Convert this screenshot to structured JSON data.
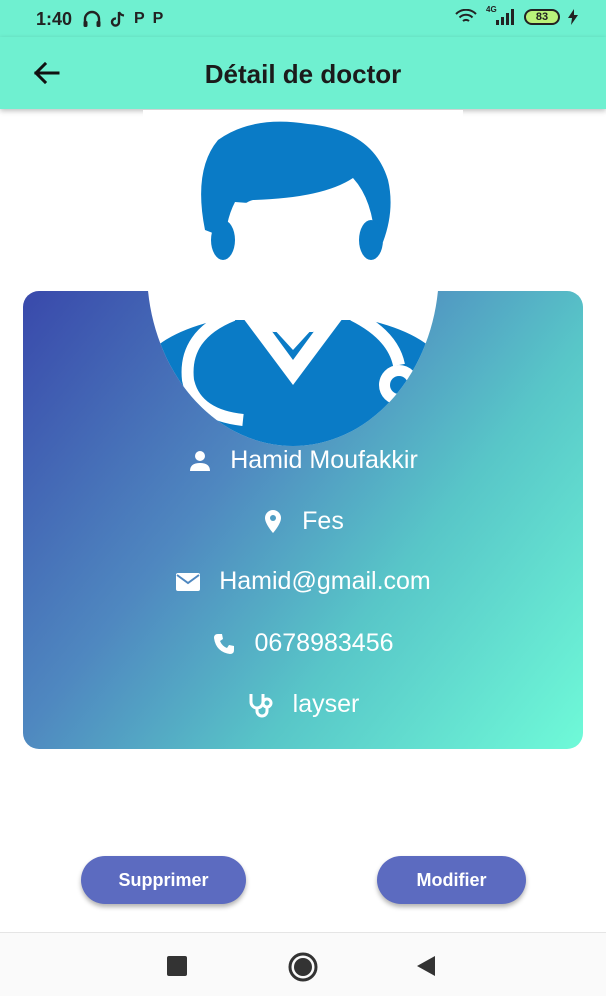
{
  "status_bar": {
    "time": "1:40",
    "left_icons": [
      "headset-icon",
      "tiktok-icon",
      "p-app-icon",
      "p-app-icon"
    ],
    "p_label": "P",
    "network": "4G",
    "battery": "83"
  },
  "app_bar": {
    "title": "Détail de doctor",
    "back_icon": "arrow-back-icon"
  },
  "doctor": {
    "name": "Hamid Moufakkir",
    "city": "Fes",
    "email": "Hamid@gmail.com",
    "phone": "0678983456",
    "specialty": "layser"
  },
  "icons": {
    "name": "person-icon",
    "city": "location-pin-icon",
    "email": "mail-icon",
    "phone": "phone-icon",
    "specialty": "stethoscope-icon"
  },
  "actions": {
    "delete_label": "Supprimer",
    "edit_label": "Modifier"
  },
  "colors": {
    "app_bar": "#6ff0d0",
    "card_start": "#3949ab",
    "card_end": "#6ffad8",
    "button": "#5c6bc0",
    "avatar": "#0a7bc6"
  }
}
